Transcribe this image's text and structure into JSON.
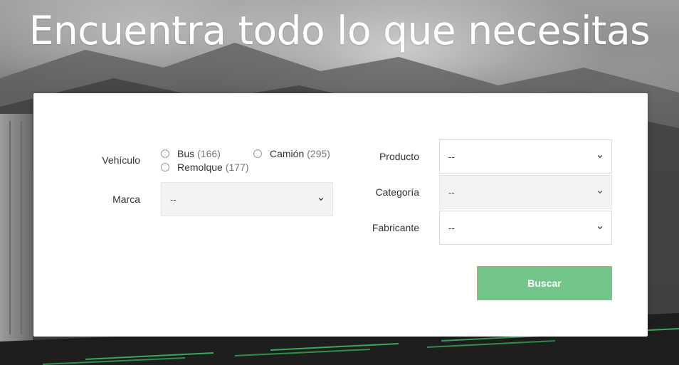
{
  "hero": {
    "title": "Encuentra todo lo que necesitas"
  },
  "form": {
    "vehicle": {
      "label": "Vehículo",
      "options": [
        {
          "name": "Bus",
          "count": "(166)"
        },
        {
          "name": "Camión",
          "count": "(295)"
        },
        {
          "name": "Remolque",
          "count": "(177)"
        }
      ]
    },
    "brand": {
      "label": "Marca",
      "value": "--"
    },
    "product": {
      "label": "Producto",
      "value": "--"
    },
    "category": {
      "label": "Categoría",
      "value": "--"
    },
    "manufacturer": {
      "label": "Fabricante",
      "value": "--"
    },
    "submit_label": "Buscar"
  },
  "colors": {
    "accent": "#72c68a",
    "card": "#ffffff",
    "disabled_field": "#f3f3f3"
  },
  "icons": {
    "select_arrow": "chevron-down-icon",
    "radio": "radio-icon"
  }
}
